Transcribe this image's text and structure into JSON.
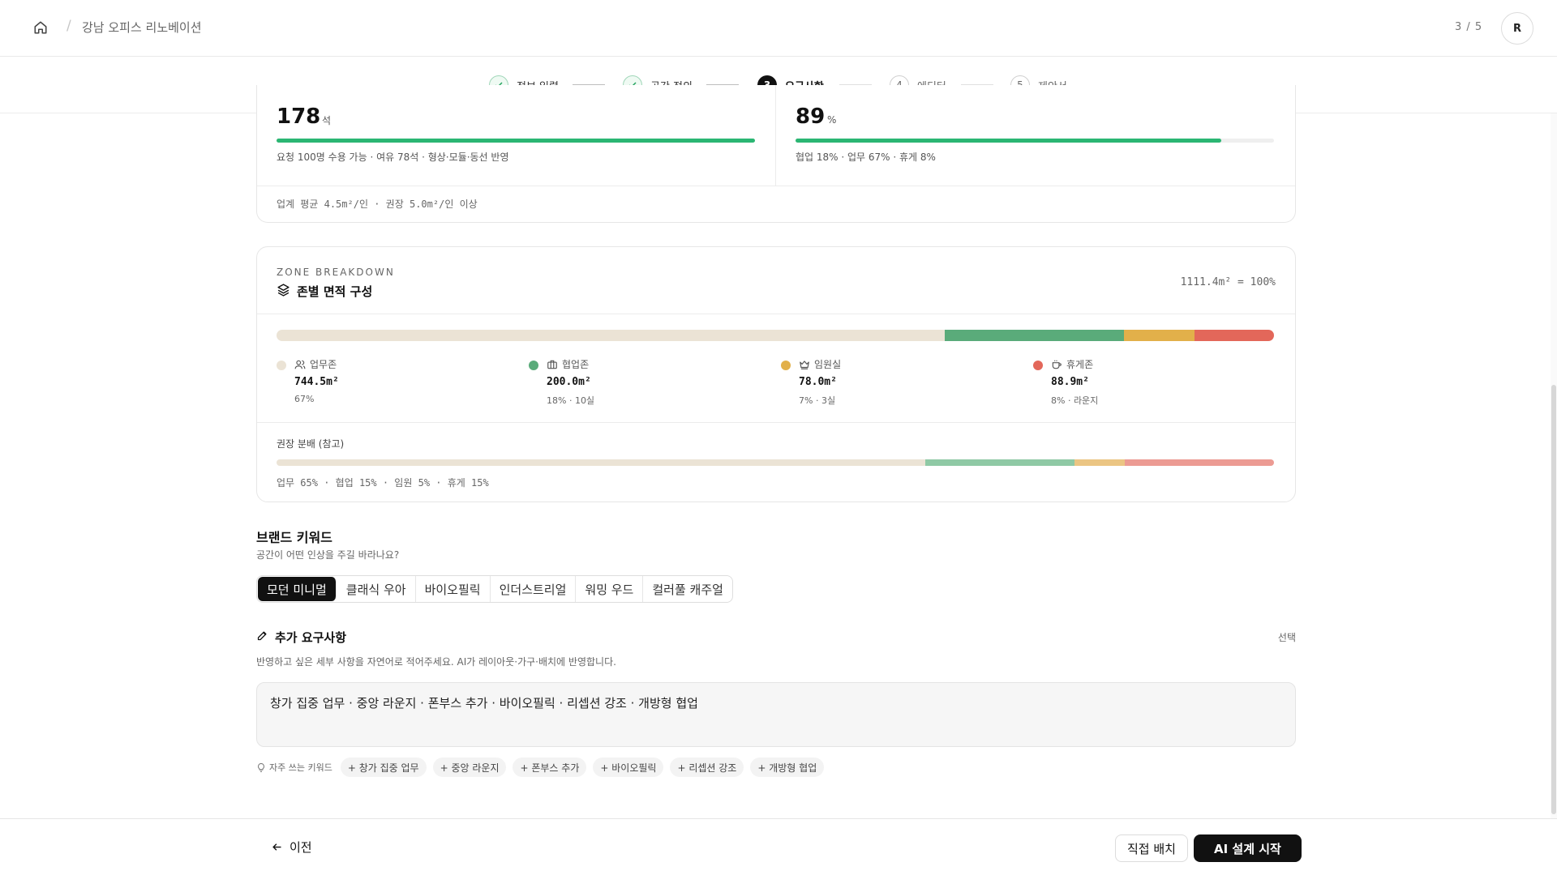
{
  "header": {
    "breadcrumb_sep": "/",
    "project_name": "강남 오피스 리노베이션",
    "page_count": "3 / 5",
    "avatar_initial": "R"
  },
  "stepper": {
    "steps": [
      {
        "number": "1",
        "label": "정보 입력",
        "state": "done"
      },
      {
        "number": "2",
        "label": "공간 정의",
        "state": "done"
      },
      {
        "number": "3",
        "label": "요구사항",
        "state": "active"
      },
      {
        "number": "4",
        "label": "에디터",
        "state": "todo"
      },
      {
        "number": "5",
        "label": "제안서",
        "state": "todo"
      }
    ]
  },
  "capacity": {
    "seats_value": "178",
    "seats_unit": "석",
    "seats_progress": 1.0,
    "seats_note": "요청 100명 수용 가능 · 여유 78석 · 형상·모듈·동선 반영",
    "efficiency_value": "89",
    "efficiency_unit": "%",
    "efficiency_progress": 0.89,
    "efficiency_note": "협업 18% · 업무 67% · 휴게 8%",
    "benchmark_note": "업계 평균 4.5m²/인 · 권장 5.0m²/인 이상"
  },
  "zones": {
    "eyebrow": "ZONE BREAKDOWN",
    "title": "존별 면적 구성",
    "total": "1111.4m² = 100%",
    "items": [
      {
        "name": "업무존",
        "area": "744.5m²",
        "sub": "67%",
        "share": 67,
        "color": "#ebe3d5",
        "icon": "users-icon"
      },
      {
        "name": "협업존",
        "area": "200.0m²",
        "sub": "18% · 10실",
        "share": 18,
        "color": "#5aab7a",
        "icon": "briefcase-icon"
      },
      {
        "name": "임원실",
        "area": "78.0m²",
        "sub": "7% · 3실",
        "share": 7,
        "color": "#e2b04a",
        "icon": "crown-icon"
      },
      {
        "name": "휴게존",
        "area": "88.9m²",
        "sub": "8% · 라운지",
        "share": 8,
        "color": "#e3675a",
        "icon": "coffee-icon"
      }
    ],
    "recommended_label": "권장 분배 (참고)",
    "recommended": [
      {
        "share": 65,
        "color": "#ebe3d5"
      },
      {
        "share": 15,
        "color": "#8fc9a5"
      },
      {
        "share": 5,
        "color": "#ebc583"
      },
      {
        "share": 15,
        "color": "#ec9b93"
      }
    ],
    "recommended_note": "업무 65% · 협업 15% · 임원 5% · 휴게 15%"
  },
  "brand": {
    "title": "브랜드 키워드",
    "subtitle": "공간이 어떤 인상을 주길 바라나요?",
    "options": [
      "모던 미니멀",
      "클래식 우아",
      "바이오필릭",
      "인더스트리얼",
      "워밍 우드",
      "컬러풀 캐주얼"
    ],
    "selected": "모던 미니멀"
  },
  "requirements": {
    "title": "추가 요구사항",
    "optional_label": "선택",
    "subtitle": "반영하고 싶은 세부 사항을 자연어로 적어주세요. AI가 레이아웃·가구·배치에 반영합니다.",
    "value": "창가 집중 업무 · 중앙 라운지 · 폰부스 추가 · 바이오필릭 · 리셉션 강조 · 개방형 협업",
    "chips_label": "자주 쓰는 키워드",
    "chips": [
      "+ 창가 집중 업무",
      "+ 중앙 라운지",
      "+ 폰부스 추가",
      "+ 바이오필릭",
      "+ 리셉션 강조",
      "+ 개방형 협업"
    ]
  },
  "footer": {
    "back_label": "이전",
    "manual_label": "직접 배치",
    "ai_label": "AI 설계 시작"
  }
}
